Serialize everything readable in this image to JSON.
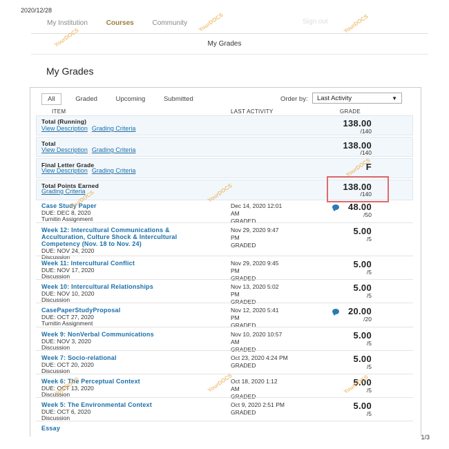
{
  "print_date": "2020/12/28",
  "page_number": "1/3",
  "nav": {
    "items": [
      "My Institution",
      "Courses",
      "Community"
    ],
    "logout_text": "Sign out"
  },
  "breadcrumb": "My Grades",
  "title": "My Grades",
  "filters": [
    "All",
    "Graded",
    "Upcoming",
    "Submitted"
  ],
  "order": {
    "label": "Order by:",
    "value": "Last Activity"
  },
  "columns": {
    "item": "ITEM",
    "last_activity": "LAST ACTIVITY",
    "grade": "GRADE"
  },
  "link_labels": {
    "view_description": "View Description",
    "grading_criteria": "Grading Criteria"
  },
  "totals": [
    {
      "name": "Total (Running)",
      "score": "138.00",
      "outof": "/140"
    },
    {
      "name": "Total",
      "score": "138.00",
      "outof": "/140"
    },
    {
      "name": "Final Letter Grade",
      "score": "F",
      "outof": ""
    },
    {
      "name": "Total Points Earned",
      "score": "138.00",
      "outof": "/140"
    }
  ],
  "items": [
    {
      "title": [
        "Case Study Paper"
      ],
      "due": "DUE: DEC 8, 2020",
      "type": "Turnitin Assignment",
      "activity": [
        "Dec 14, 2020 12:01",
        "AM",
        "GRADED"
      ],
      "score": "48.00",
      "outof": "/50",
      "comment": true
    },
    {
      "title": [
        "Week 12: Intercultural Communications &",
        "Acculturation, Culture Shock & Intercultural",
        "Competency (Nov. 18 to Nov. 24)"
      ],
      "due": "DUE: NOV 24, 2020",
      "type": "Discussion",
      "activity": [
        "Nov 29, 2020 9:47",
        "PM",
        "GRADED"
      ],
      "score": "5.00",
      "outof": "/5",
      "comment": false
    },
    {
      "title": [
        "Week 11: Intercultural Conflict"
      ],
      "due": "DUE: NOV 17, 2020",
      "type": "Discussion",
      "activity": [
        "Nov 29, 2020 9:45",
        "PM",
        "GRADED"
      ],
      "score": "5.00",
      "outof": "/5",
      "comment": false
    },
    {
      "title": [
        "Week 10: Intercultural Relationships"
      ],
      "due": "DUE: NOV 10, 2020",
      "type": "Discussion",
      "activity": [
        "Nov 13, 2020 5:02",
        "PM",
        "GRADED"
      ],
      "score": "5.00",
      "outof": "/5",
      "comment": false
    },
    {
      "title": [
        "CasePaperStudyProposal"
      ],
      "due": "DUE: OCT 27, 2020",
      "type": "Turnitin Assignment",
      "activity": [
        "Nov 12, 2020 5:41",
        "PM",
        "GRADED"
      ],
      "score": "20.00",
      "outof": "/20",
      "comment": true
    },
    {
      "title": [
        "Week 9: NonVerbal Communications"
      ],
      "due": "DUE: NOV 3, 2020",
      "type": "Discussion",
      "activity": [
        "Nov 10, 2020 10:57",
        "AM",
        "GRADED"
      ],
      "score": "5.00",
      "outof": "/5",
      "comment": false
    },
    {
      "title": [
        "Week 7: Socio-relational"
      ],
      "due": "DUE: OCT 20, 2020",
      "type": "Discussion",
      "activity": [
        "Oct 23, 2020 4:24 PM",
        "GRADED"
      ],
      "score": "5.00",
      "outof": "/5",
      "comment": false
    },
    {
      "title": [
        "Week 6: The Perceptual Context"
      ],
      "due": "DUE: OCT 13, 2020",
      "type": "Discussion",
      "activity": [
        "Oct 18, 2020 1:12",
        "AM",
        "GRADED"
      ],
      "score": "5.00",
      "outof": "/5",
      "comment": false
    },
    {
      "title": [
        "Week 5: The Environmental Context"
      ],
      "due": "DUE: OCT 6, 2020",
      "type": "Discussion",
      "activity": [
        "Oct 9, 2020 2:51 PM",
        "GRADED"
      ],
      "score": "5.00",
      "outof": "/5",
      "comment": false
    },
    {
      "title": [
        "Essay"
      ],
      "due": "",
      "type": "",
      "activity": [],
      "score": "",
      "outof": "",
      "comment": false
    }
  ],
  "watermark_text": "YourDOCS"
}
